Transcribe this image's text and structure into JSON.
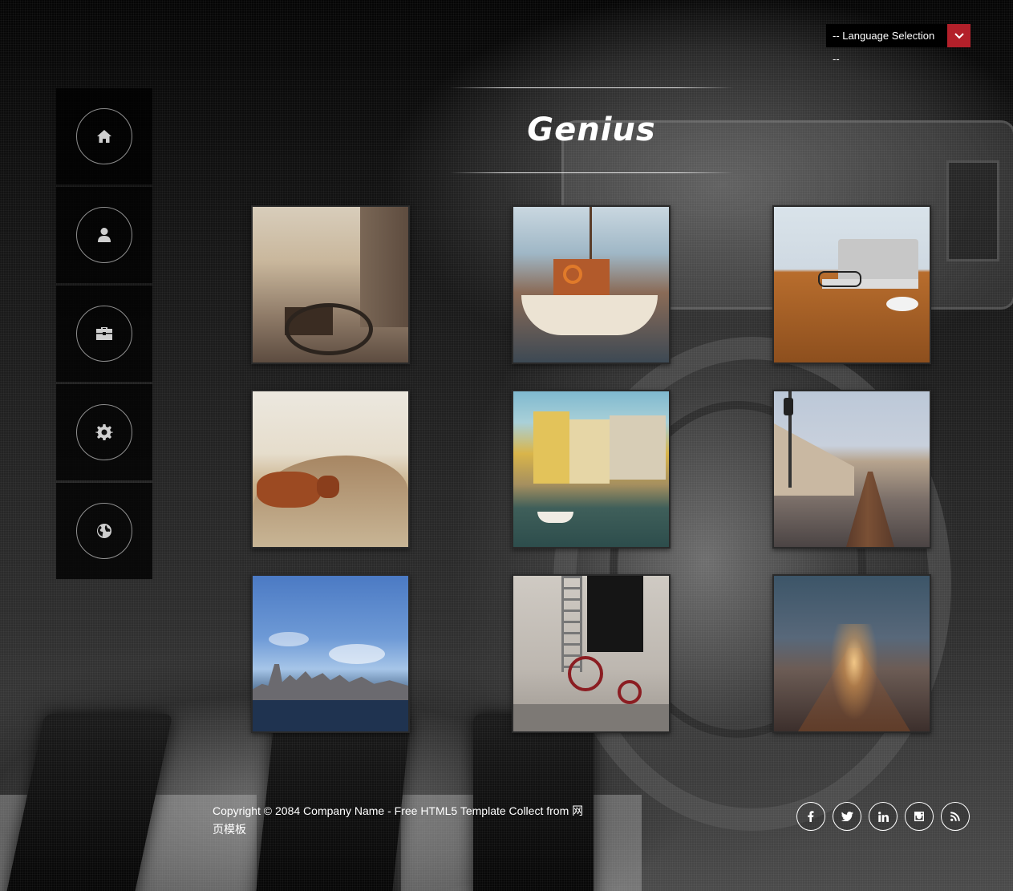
{
  "language": {
    "label": "-- Language Selection --",
    "accent": "#b3202a"
  },
  "sidebar": {
    "items": [
      {
        "icon": "home-icon"
      },
      {
        "icon": "user-icon"
      },
      {
        "icon": "briefcase-icon"
      },
      {
        "icon": "gear-icon"
      },
      {
        "icon": "globe-icon"
      }
    ]
  },
  "header": {
    "logo": "Genius",
    "logo_accent": "#c0202a"
  },
  "gallery": {
    "items": [
      {
        "photo": "street-bicycle"
      },
      {
        "photo": "sailboat-harbor"
      },
      {
        "photo": "laptop-glasses-desk"
      },
      {
        "photo": "highland-cow"
      },
      {
        "photo": "canal-houses"
      },
      {
        "photo": "railway-coast"
      },
      {
        "photo": "city-skyline"
      },
      {
        "photo": "red-tricycle"
      },
      {
        "photo": "foggy-railway"
      }
    ]
  },
  "footer": {
    "copyright": "Copyright © 2084 Company Name - Free HTML5 Template Collect from 网页模板",
    "social": [
      {
        "icon": "facebook-icon"
      },
      {
        "icon": "twitter-icon"
      },
      {
        "icon": "linkedin-icon"
      },
      {
        "icon": "instagram-icon"
      },
      {
        "icon": "rss-icon"
      }
    ]
  }
}
